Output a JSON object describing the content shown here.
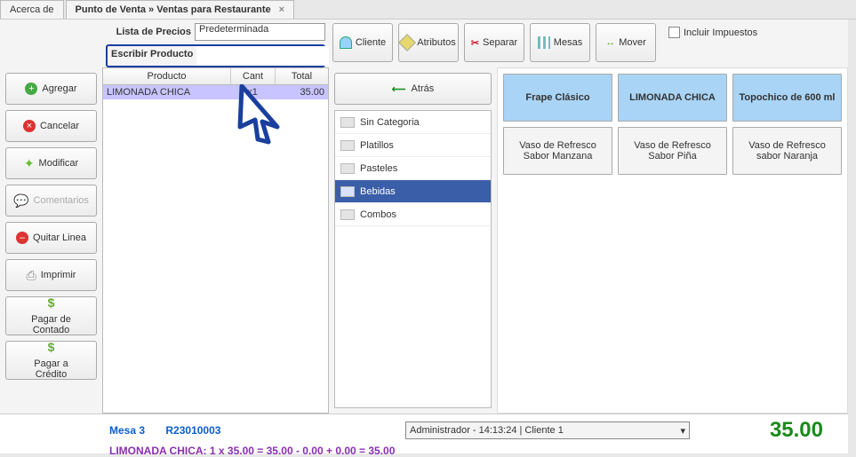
{
  "tabs": {
    "about": "Acerca de",
    "main": "Punto de Venta » Ventas para Restaurante"
  },
  "header": {
    "price_list_label": "Lista de Precios",
    "price_list_value": "Predeterminada",
    "search_label": "Escribir Producto",
    "search_value": "",
    "include_tax_label": "Incluir Impuestos",
    "btn_cliente": "Cliente",
    "btn_atributos": "Atributos",
    "btn_separar": "Separar",
    "btn_mesas": "Mesas",
    "btn_mover": "Mover"
  },
  "left_actions": {
    "agregar": "Agregar",
    "cancelar": "Cancelar",
    "modificar": "Modificar",
    "comentarios": "Comentarios",
    "quitar": "Quitar Linea",
    "imprimir": "Imprimir",
    "pagar_contado_l1": "Pagar de",
    "pagar_contado_l2": "Contado",
    "pagar_credito_l1": "Pagar a",
    "pagar_credito_l2": "Crédito"
  },
  "order": {
    "col_producto": "Producto",
    "col_cant": "Cant",
    "col_total": "Total",
    "rows": [
      {
        "producto": "LIMONADA CHICA",
        "cant": "x1",
        "total": "35.00"
      }
    ]
  },
  "back_label": "Atrás",
  "categories": [
    {
      "label": "Sin Categoria",
      "selected": false
    },
    {
      "label": "Platillos",
      "selected": false
    },
    {
      "label": "Pasteles",
      "selected": false
    },
    {
      "label": "Bebidas",
      "selected": true
    },
    {
      "label": "Combos",
      "selected": false
    }
  ],
  "products": [
    {
      "label": "Frape Clásico",
      "hl": true
    },
    {
      "label": "LIMONADA CHICA",
      "hl": true
    },
    {
      "label": "Topochico de 600 ml",
      "hl": true
    },
    {
      "label": "Vaso de Refresco Sabor Manzana",
      "hl": false
    },
    {
      "label": "Vaso de Refresco Sabor Piña",
      "hl": false
    },
    {
      "label": "Vaso de Refresco sabor Naranja",
      "hl": false
    }
  ],
  "status": {
    "mesa": "Mesa 3",
    "ticket": "R23010003",
    "admin": "Administrador - 14:13:24 | Cliente 1",
    "total": "35.00",
    "calc": "LIMONADA CHICA: 1 x 35.00 = 35.00 - 0.00 + 0.00 = 35.00"
  }
}
